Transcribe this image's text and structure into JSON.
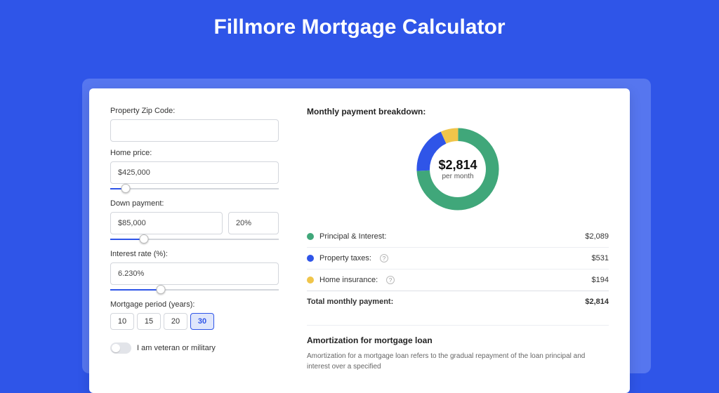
{
  "title": "Fillmore Mortgage Calculator",
  "form": {
    "zip": {
      "label": "Property Zip Code:",
      "value": ""
    },
    "home_price": {
      "label": "Home price:",
      "value": "$425,000",
      "slider_pct": 9
    },
    "down_payment": {
      "label": "Down payment:",
      "amount": "$85,000",
      "percent": "20%",
      "slider_pct": 20
    },
    "interest_rate": {
      "label": "Interest rate (%):",
      "value": "6.230%",
      "slider_pct": 30
    },
    "period": {
      "label": "Mortgage period (years):",
      "options": [
        "10",
        "15",
        "20",
        "30"
      ],
      "active": "30"
    },
    "veteran": {
      "label": "I am veteran or military",
      "checked": false
    }
  },
  "breakdown": {
    "title": "Monthly payment breakdown:",
    "center_amount": "$2,814",
    "center_sub": "per month",
    "items": [
      {
        "label": "Principal & Interest:",
        "value": "$2,089",
        "color": "g"
      },
      {
        "label": "Property taxes:",
        "value": "$531",
        "color": "b",
        "help": true
      },
      {
        "label": "Home insurance:",
        "value": "$194",
        "color": "y",
        "help": true
      }
    ],
    "total": {
      "label": "Total monthly payment:",
      "value": "$2,814"
    }
  },
  "amortization": {
    "title": "Amortization for mortgage loan",
    "text": "Amortization for a mortgage loan refers to the gradual repayment of the loan principal and interest over a specified"
  },
  "chart_data": {
    "type": "pie",
    "title": "Monthly payment breakdown",
    "series": [
      {
        "name": "Principal & Interest",
        "value": 2089,
        "color": "#40a77a"
      },
      {
        "name": "Property taxes",
        "value": 531,
        "color": "#2f55e8"
      },
      {
        "name": "Home insurance",
        "value": 194,
        "color": "#f0c54a"
      }
    ],
    "total": 2814
  }
}
